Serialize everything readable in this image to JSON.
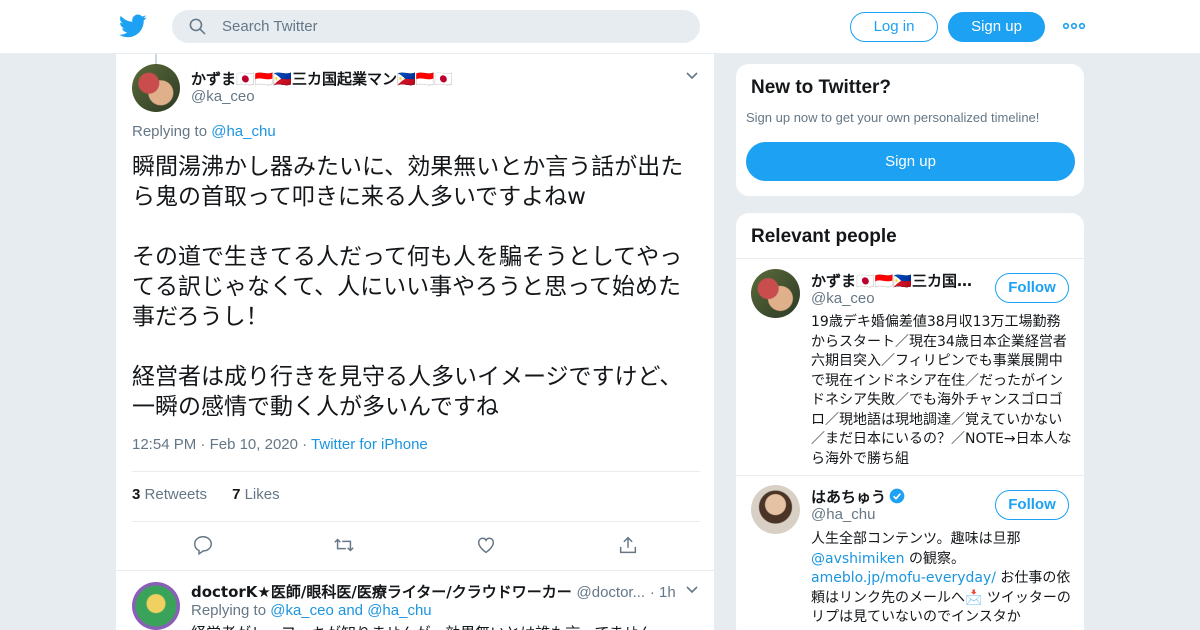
{
  "topbar": {
    "search_placeholder": "Search Twitter",
    "login_label": "Log in",
    "signup_label": "Sign up",
    "brand_color": "#1da1f2"
  },
  "tweet": {
    "author_name": "かずま🇯🇵🇮🇩🇵🇭三カ国起業マン🇵🇭🇮🇩🇯🇵",
    "author_handle": "@ka_ceo",
    "replying_prefix": "Replying to",
    "replying_to": "@ha_chu",
    "text": "瞬間湯沸かし器みたいに、効果無いとか言う話が出たら鬼の首取って叩きに来る人多いですよねw\n\nその道で生きてる人だって何も人を騙そうとしてやってる訳じゃなくて、人にいい事やろうと思って始めた事だろうし！\n\n経営者は成り行きを見守る人多いイメージですけど、一瞬の感情で動く人が多いんですね",
    "time": "12:54 PM",
    "date": "Feb 10, 2020",
    "source": "Twitter for iPhone",
    "retweets_count": "3",
    "retweets_label": "Retweets",
    "likes_count": "7",
    "likes_label": "Likes"
  },
  "reply": {
    "author_name": "doctorK★医師/眼科医/医療ライター/クラウドワーカー",
    "author_handle": "@doctor...",
    "time_ago": "1h",
    "replying_prefix": "Replying to",
    "replying_to_1": "@ka_ceo",
    "replying_and": "and",
    "replying_to_2": "@ha_chu",
    "text_preview": "経営者がレ…ファキが知りませんが、効果無いとは誰も言ってません"
  },
  "sidebar": {
    "new_title": "New to Twitter?",
    "new_text": "Sign up now to get your own personalized timeline!",
    "new_signup_label": "Sign up",
    "relevant_title": "Relevant people",
    "people": [
      {
        "name": "かずま🇯🇵🇮🇩🇵🇭三カ国…",
        "handle": "@ka_ceo",
        "follow_label": "Follow",
        "bio": "19歳デキ婚偏差値38月収13万工場勤務からスタート／現在34歳日本企業経営者六期目突入／フィリピンでも事業展開中で現在インドネシア在住／だったがインドネシア失敗／でも海外チャンスゴロゴロ／現地語は現地調達／覚えていかない／まだ日本にいるの？／NOTE→日本人なら海外で勝ち組"
      },
      {
        "name": "はあちゅう",
        "handle": "@ha_chu",
        "follow_label": "Follow",
        "bio_1": "人生全部コンテンツ。趣味は旦那",
        "bio_link_1": "@avshimiken",
        "bio_2": " の観察。",
        "bio_link_2": "ameblo.jp/mofu-everyday/",
        "bio_3": " お仕事の依頼はリンク先のメールへ📩 ツイッターのリプは見ていないのでインスタか"
      }
    ]
  }
}
